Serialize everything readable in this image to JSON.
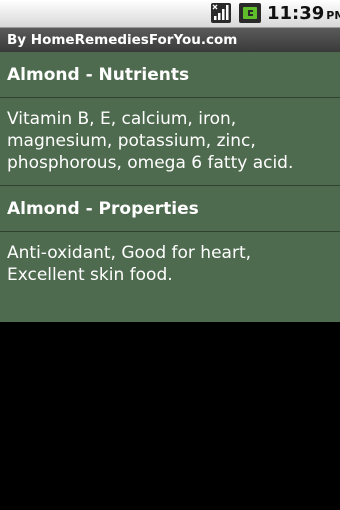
{
  "status_bar": {
    "time": "11:39",
    "ampm": "PM",
    "icons": [
      "signal-icon",
      "battery-icon"
    ]
  },
  "app": {
    "title": "By HomeRemediesForYou.com"
  },
  "sections": [
    {
      "heading": "Almond - Nutrients",
      "text": "Vitamin B, E, calcium, iron, magnesium, potassium, zinc, phosphorous, omega 6 fatty acid."
    },
    {
      "heading": "Almond - Properties",
      "text": "Anti-oxidant, Good for heart, Excellent skin food."
    }
  ],
  "colors": {
    "content_background": "#4f6b4f",
    "divider": "#2f422f",
    "title_bar": "#474747",
    "status_bar": "#e8e8e8",
    "screen_background": "#000000"
  }
}
